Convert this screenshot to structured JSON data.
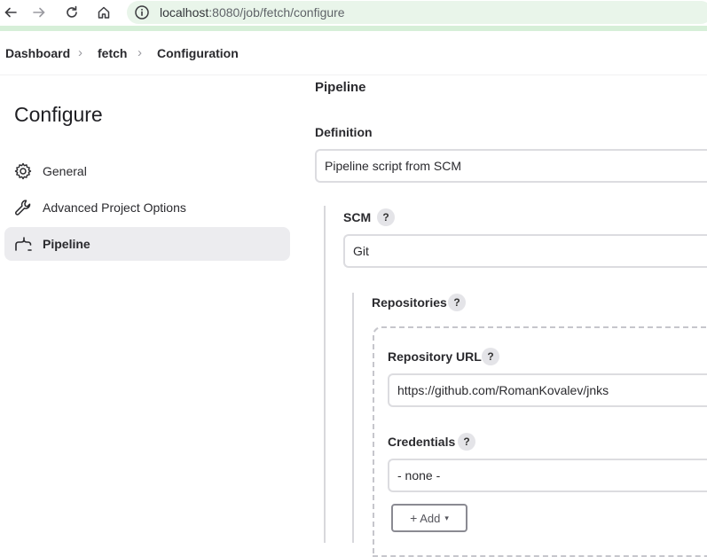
{
  "browser": {
    "url_host": "localhost",
    "url_rest": ":8080/job/fetch/configure"
  },
  "breadcrumb": [
    {
      "label": "Dashboard"
    },
    {
      "label": "fetch"
    },
    {
      "label": "Configuration"
    }
  ],
  "breadcrumb_separator": "›",
  "sidebar": {
    "title": "Configure",
    "items": [
      {
        "label": "General",
        "icon": "gear-icon",
        "active": false
      },
      {
        "label": "Advanced Project Options",
        "icon": "wrench-icon",
        "active": false
      },
      {
        "label": "Pipeline",
        "icon": "pipeline-icon",
        "active": true
      }
    ]
  },
  "main": {
    "section_title": "Pipeline",
    "definition": {
      "label": "Definition",
      "value": "Pipeline script from SCM"
    },
    "scm": {
      "label": "SCM",
      "help": "?",
      "value": "Git"
    },
    "repositories": {
      "label": "Repositories",
      "help": "?",
      "repository_url": {
        "label": "Repository URL",
        "help": "?",
        "value": "https://github.com/RomanKovalev/jnks"
      },
      "credentials": {
        "label": "Credentials",
        "help": "?",
        "value": "- none -"
      },
      "add_button": {
        "plus": "+",
        "label": "Add",
        "caret": "▾"
      }
    }
  },
  "colors": {
    "accent_strip": "#d6efd8",
    "active_item_bg": "#ececef"
  }
}
